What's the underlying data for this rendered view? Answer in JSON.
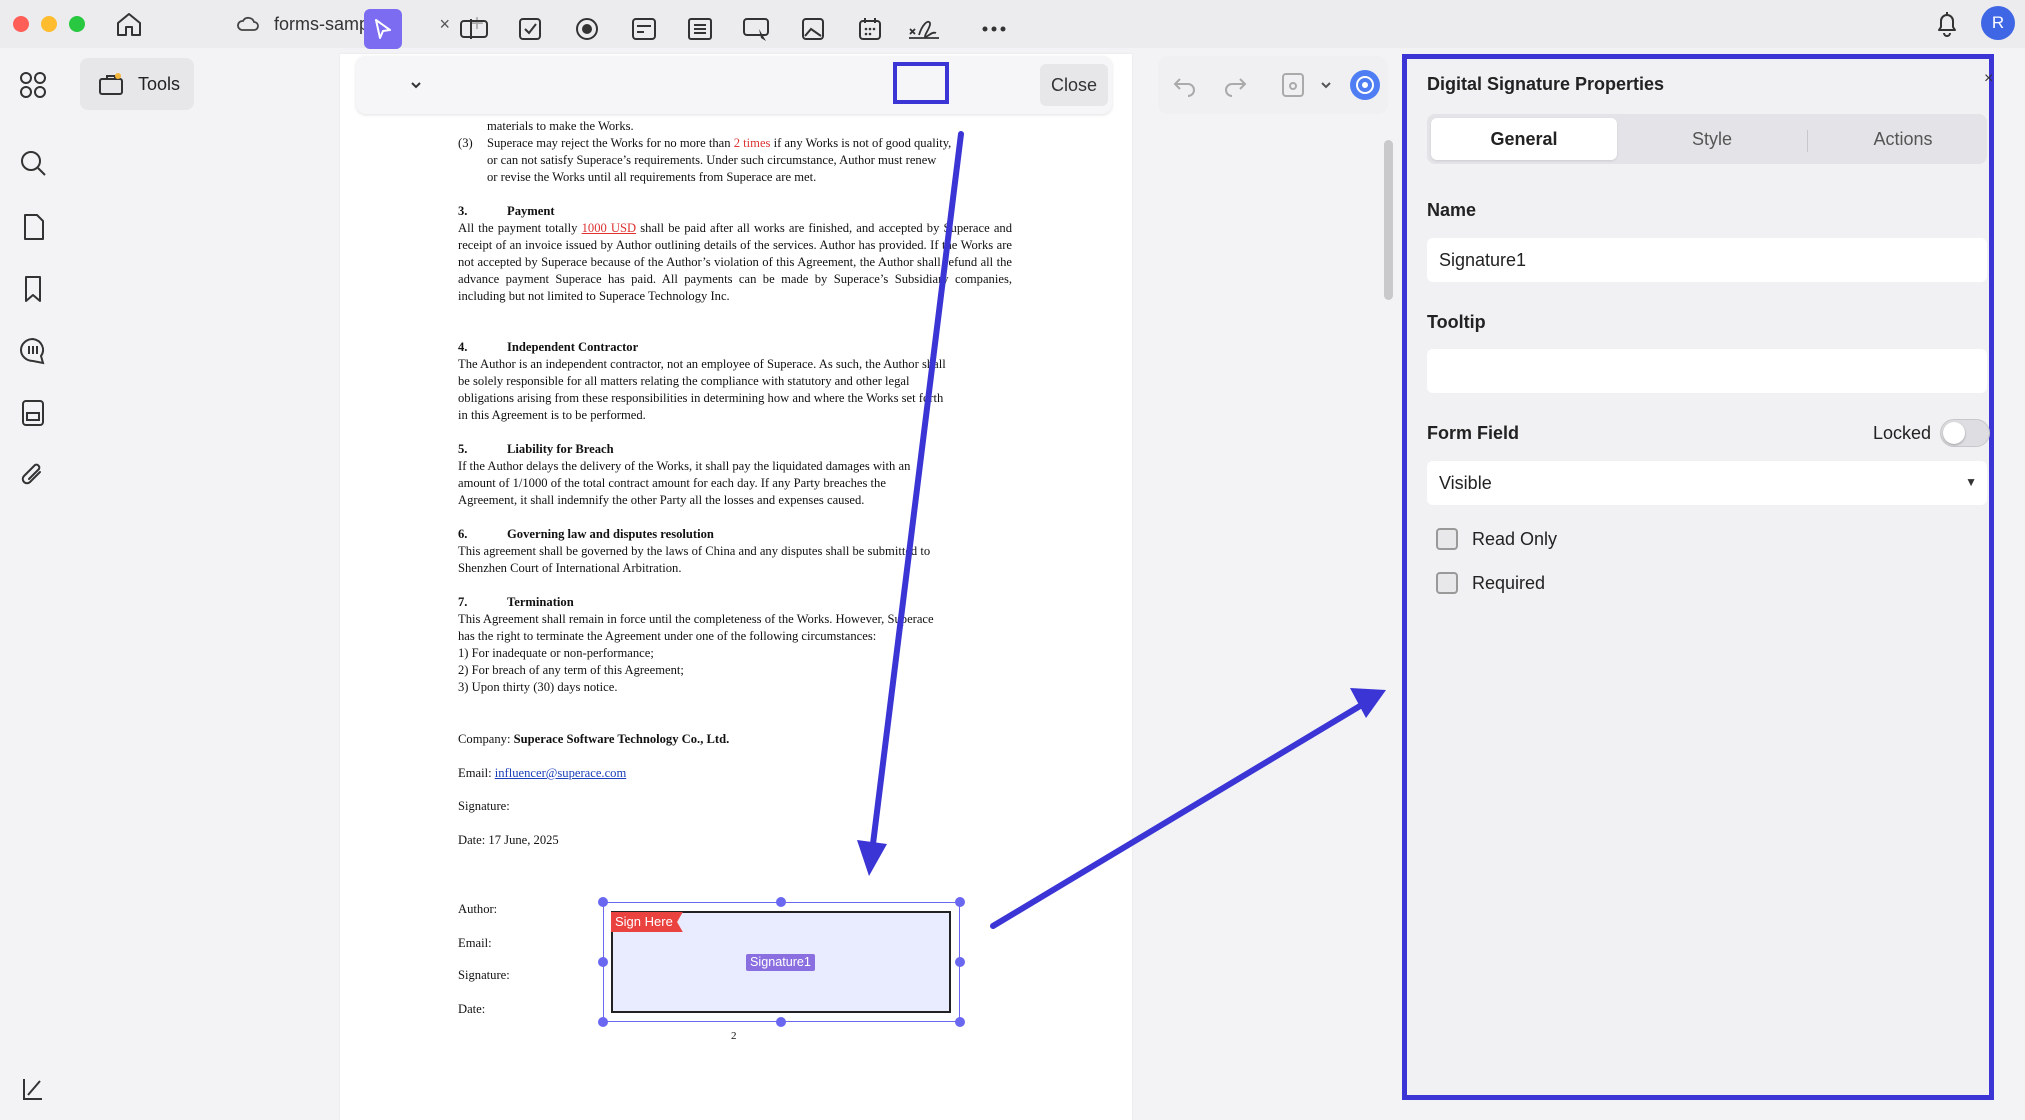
{
  "titlebar": {
    "tab_title": "forms-samples",
    "tab_close": "×",
    "tab_add": "+",
    "avatar_initial": "R"
  },
  "sidebar": {
    "tools_label": "Tools",
    "icons": [
      "apps-grid-icon",
      "search-icon",
      "pages-icon",
      "bookmark-icon",
      "comments-icon",
      "form-icon",
      "attachment-icon",
      "collapse-panel-icon"
    ]
  },
  "form_toolbar": {
    "icons": [
      "select-pointer-icon",
      "text-field-icon",
      "checkbox-icon",
      "radio-button-icon",
      "combo-box-icon",
      "list-box-icon",
      "button-icon",
      "image-field-icon",
      "date-field-icon",
      "signature-field-icon",
      "more-icon"
    ],
    "active_tool": "signature-field-icon",
    "close_label": "Close"
  },
  "right_toolbar": {
    "icons": [
      "undo-icon",
      "redo-icon",
      "save-icon",
      "ai-assistant-icon"
    ]
  },
  "document": {
    "clause_cont_1": "materials to make the Works.",
    "clause_3_num": "(3)",
    "clause_3_line1_a": "Superace may reject the Works for no more than ",
    "clause_3_line1_red": "2 times",
    "clause_3_line1_b": " if any Works is not of good quality,",
    "clause_3_line2": "or can not satisfy Superace’s requirements. Under such circumstance, Author must renew",
    "clause_3_line3": "or revise the Works until all requirements from Superace are met.",
    "s3_num": "3.",
    "s3_title": "Payment",
    "s3_a": "All the payment totally ",
    "s3_red": "1000 USD",
    "s3_b": " shall be paid after all works are finished, and accepted by Superace and receipt of an invoice issued by Author outlining details of the services. Author has provided. If the Works are not accepted by Superace because of the Author’s violation of this Agreement, the Author shall refund all the advance payment Superace has paid. All payments can be made by Superace’s Subsidiary companies, including but not limited to Superace Technology Inc.",
    "s4_num": "4.",
    "s4_title": "Independent Contractor",
    "s4_l1": "The Author is an independent contractor, not an employee of Superace. As such, the Author shall",
    "s4_l2": "be solely responsible for all matters relating the compliance with statutory and other legal",
    "s4_l3": "obligations arising from these responsibilities in determining how and where the Works set forth",
    "s4_l4": "in this Agreement is to be performed.",
    "s5_num": "5.",
    "s5_title": "Liability for Breach",
    "s5_l1": "If the Author delays the delivery of the Works, it shall pay the liquidated damages with an",
    "s5_l2": "amount of 1/1000 of the total contract amount for each day. If any Party breaches the",
    "s5_l3": "Agreement, it shall indemnify the other Party all the losses and expenses caused.",
    "s6_num": "6.",
    "s6_title": "Governing law and disputes resolution",
    "s6_l1": "This agreement shall be governed by the laws of China and any disputes shall be submitted to",
    "s6_l2": "Shenzhen Court of International Arbitration.",
    "s7_num": "7.",
    "s7_title": "Termination",
    "s7_l1": "This Agreement shall remain in force until the completeness of the Works. However, Superace",
    "s7_l2": "has the right to terminate the Agreement under one of the following circumstances:",
    "s7_l3": "1) For inadequate or non-performance;",
    "s7_l4": "2) For breach of any term of this Agreement;",
    "s7_l5": "3)  Upon thirty (30) days notice.",
    "company_label": "Company: ",
    "company_value": "Superace Software Technology Co., Ltd.",
    "email_label": "Email: ",
    "email_value": "influencer@superace.com",
    "signature_label": "Signature:",
    "date_label": "Date: 17 June, 2025",
    "author_label": "Author:",
    "email2_label": "Email:",
    "signature2_label": "Signature:",
    "date2_label": "Date:",
    "page_number": "2",
    "sign_here_tag": "Sign Here",
    "field_name_tag": "Signature1"
  },
  "panel": {
    "title": "Digital Signature Properties",
    "close": "×",
    "tabs": [
      "General",
      "Style",
      "Actions"
    ],
    "selected_tab": "General",
    "name_label": "Name",
    "name_value": "Signature1",
    "tooltip_label": "Tooltip",
    "tooltip_value": "",
    "form_field_label": "Form Field",
    "locked_label": "Locked",
    "locked": false,
    "visibility_value": "Visible",
    "read_only_label": "Read Only",
    "read_only": false,
    "required_label": "Required",
    "required": false
  },
  "colors": {
    "accent": "#7b6cf2",
    "annotation_blue": "#3b35d6",
    "sign_here_red": "#e9423f",
    "field_fill": "#e9ebff",
    "avatar": "#3f66e4"
  }
}
